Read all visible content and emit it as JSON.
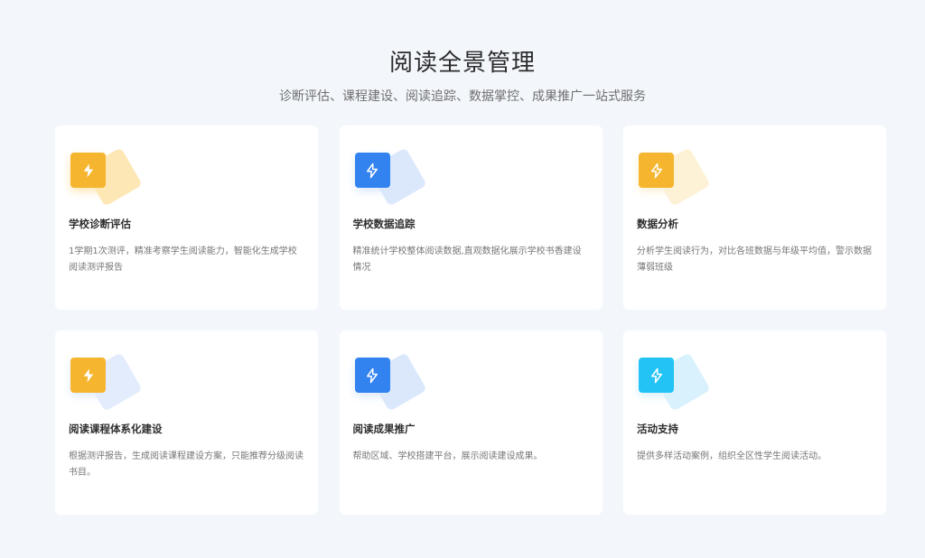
{
  "header": {
    "title": "阅读全景管理",
    "subtitle": "诊断评估、课程建设、阅读追踪、数据掌控、成果推广一站式服务"
  },
  "cards": [
    {
      "title": "学校诊断评估",
      "desc": "1学期1次测评，精准考察学生阅读能力，智能化生成学校阅读测评报告",
      "icon": "lightning-bolt-icon",
      "color": "#f5b52e",
      "shadow": "#fde7b4",
      "stroke": "filled"
    },
    {
      "title": "学校数据追踪",
      "desc": "精准统计学校整体阅读数据,直观数据化展示学校书香建设情况",
      "icon": "lightning-bolt-icon",
      "color": "#3282f0",
      "shadow": "#dbe8fc",
      "stroke": "outline"
    },
    {
      "title": "数据分析",
      "desc": "分析学生阅读行为，对比各班数据与年级平均值，警示数据薄弱班级",
      "icon": "lightning-bolt-icon",
      "color": "#f5b52e",
      "shadow": "#fdf1d6",
      "stroke": "outline"
    },
    {
      "title": "阅读课程体系化建设",
      "desc": "根据测评报告，生成阅读课程建设方案，只能推荐分级阅读书目。",
      "icon": "lightning-bolt-icon",
      "color": "#f5b52e",
      "shadow": "#e2ecfc",
      "stroke": "filled"
    },
    {
      "title": "阅读成果推广",
      "desc": "帮助区域、学校搭建平台，展示阅读建设成果。",
      "icon": "lightning-bolt-icon",
      "color": "#3282f0",
      "shadow": "#dbe8fc",
      "stroke": "outline"
    },
    {
      "title": "活动支持",
      "desc": "提供多样活动案例，组织全区性学生阅读活动。",
      "icon": "lightning-bolt-icon",
      "color": "#23c4f5",
      "shadow": "#d8f1fc",
      "stroke": "outline"
    }
  ]
}
